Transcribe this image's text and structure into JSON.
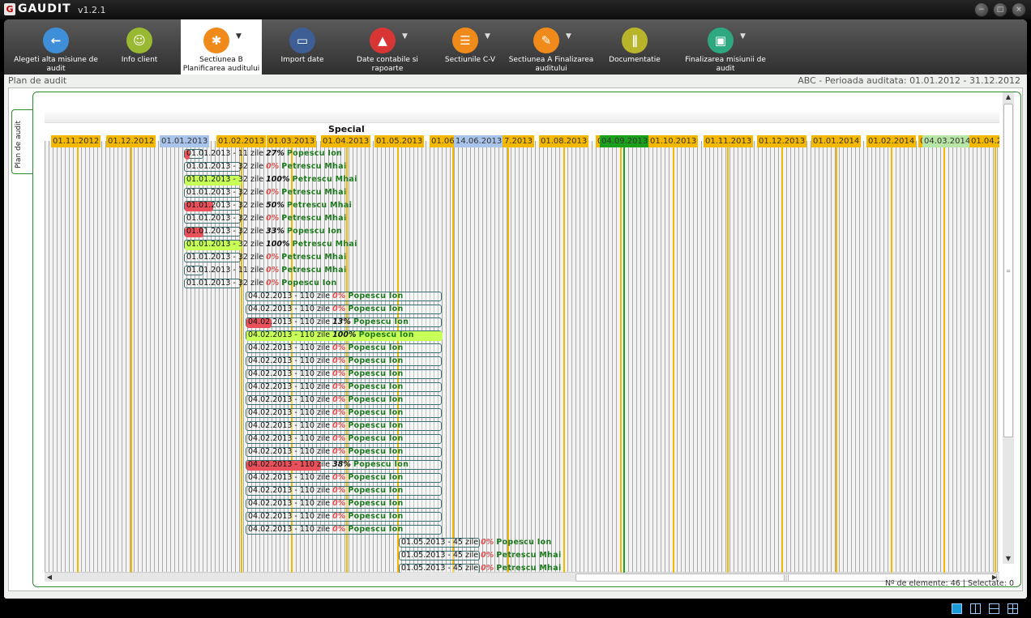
{
  "app": {
    "title": "GAUDIT",
    "version": "v1.2.1",
    "icon": "app-logo-icon"
  },
  "window_controls": [
    "minimize",
    "maximize",
    "close"
  ],
  "toolbar": [
    {
      "label": "Alegeti alta misiune de audit",
      "icon": "arrow-left-icon",
      "color": "#3f8fd8",
      "dropdown": false,
      "active": false
    },
    {
      "label": "Info client",
      "icon": "users-icon",
      "color": "#9ab932",
      "dropdown": false,
      "active": false
    },
    {
      "label": "Sectiunea B Planificarea auditului",
      "icon": "puzzle-icon",
      "color": "#f08a1a",
      "dropdown": true,
      "active": true
    },
    {
      "label": "Import date",
      "icon": "monitor-import-icon",
      "color": "#3d5f96",
      "dropdown": false,
      "active": false
    },
    {
      "label": "Date contabile si rapoarte",
      "icon": "presentation-chart-icon",
      "color": "#d83535",
      "dropdown": true,
      "active": false
    },
    {
      "label": "Sectiunile C-V",
      "icon": "document-icon",
      "color": "#f08a1a",
      "dropdown": true,
      "active": false
    },
    {
      "label": "Sectiunea A Finalizarea auditului",
      "icon": "pen-icon",
      "color": "#f08a1a",
      "dropdown": true,
      "active": false
    },
    {
      "label": "Documentatie",
      "icon": "books-icon",
      "color": "#b9b52a",
      "dropdown": false,
      "active": false
    },
    {
      "label": "Finalizarea misiunii de audit",
      "icon": "briefcase-icon",
      "color": "#2ea880",
      "dropdown": true,
      "active": false
    }
  ],
  "breadcrumb": "Plan de audit",
  "period": "ABC - Perioada auditata: 01.01.2012 - 31.12.2012",
  "side_tab": "Plan de audit",
  "timeline": {
    "group_label": "Special",
    "months": [
      {
        "label": "01.11.2012",
        "style": "month"
      },
      {
        "label": "01.12.2012",
        "style": "month"
      },
      {
        "label": "01.01.2013",
        "style": "blue"
      },
      {
        "label": "01.02.2013",
        "style": "month"
      },
      {
        "label": "01.03.2013",
        "style": "month"
      },
      {
        "label": "01.04.2013",
        "style": "month"
      },
      {
        "label": "01.05.2013",
        "style": "month"
      },
      {
        "label": "01.06",
        "style": "month"
      },
      {
        "label": "14.06.2013",
        "style": "ref"
      },
      {
        "label": "7.2013",
        "style": "month"
      },
      {
        "label": "01.08.2013",
        "style": "month"
      },
      {
        "label": "0",
        "style": "month"
      },
      {
        "label": "04.09.2013",
        "style": "green"
      },
      {
        "label": "01.10.2013",
        "style": "month"
      },
      {
        "label": "01.11.2013",
        "style": "month"
      },
      {
        "label": "01.12.2013",
        "style": "month"
      },
      {
        "label": "01.01.2014",
        "style": "month"
      },
      {
        "label": "01.02.2014",
        "style": "month"
      },
      {
        "label": "0",
        "style": "month"
      },
      {
        "label": "04.03.2014",
        "style": "lightgreen"
      },
      {
        "label": "01.04.201",
        "style": "month"
      }
    ],
    "tasks": [
      {
        "start": "01.01.2013",
        "days": "11",
        "pct": "27%",
        "pct_num": 27,
        "owner": "Popescu Ion"
      },
      {
        "start": "01.01.2013",
        "days": "32",
        "pct": "0%",
        "pct_num": 0,
        "owner": "Petrescu Mhai"
      },
      {
        "start": "01.01.2013",
        "days": "32",
        "pct": "100%",
        "pct_num": 100,
        "owner": "Petrescu Mhai"
      },
      {
        "start": "01.01.2013",
        "days": "32",
        "pct": "0%",
        "pct_num": 0,
        "owner": "Petrescu Mhai"
      },
      {
        "start": "01.01.2013",
        "days": "32",
        "pct": "50%",
        "pct_num": 50,
        "owner": "Petrescu Mhai"
      },
      {
        "start": "01.01.2013",
        "days": "32",
        "pct": "0%",
        "pct_num": 0,
        "owner": "Petrescu Mhai"
      },
      {
        "start": "01.01.2013",
        "days": "32",
        "pct": "33%",
        "pct_num": 33,
        "owner": "Popescu Ion"
      },
      {
        "start": "01.01.2013",
        "days": "32",
        "pct": "100%",
        "pct_num": 100,
        "owner": "Petrescu Mhai"
      },
      {
        "start": "01.01.2013",
        "days": "32",
        "pct": "0%",
        "pct_num": 0,
        "owner": "Petrescu Mhai"
      },
      {
        "start": "01.01.2013",
        "days": "11",
        "pct": "0%",
        "pct_num": 0,
        "owner": "Petrescu Mhai"
      },
      {
        "start": "01.01.2013",
        "days": "32",
        "pct": "0%",
        "pct_num": 0,
        "owner": "Popescu Ion"
      },
      {
        "start": "04.02.2013",
        "days": "110",
        "pct": "0%",
        "pct_num": 0,
        "owner": "Popescu Ion"
      },
      {
        "start": "04.02.2013",
        "days": "110",
        "pct": "0%",
        "pct_num": 0,
        "owner": "Popescu Ion"
      },
      {
        "start": "04.02.2013",
        "days": "110",
        "pct": "13%",
        "pct_num": 13,
        "owner": "Popescu Ion"
      },
      {
        "start": "04.02.2013",
        "days": "110",
        "pct": "100%",
        "pct_num": 100,
        "owner": "Popescu Ion"
      },
      {
        "start": "04.02.2013",
        "days": "110",
        "pct": "0%",
        "pct_num": 0,
        "owner": "Popescu Ion"
      },
      {
        "start": "04.02.2013",
        "days": "110",
        "pct": "0%",
        "pct_num": 0,
        "owner": "Popescu Ion"
      },
      {
        "start": "04.02.2013",
        "days": "110",
        "pct": "0%",
        "pct_num": 0,
        "owner": "Popescu Ion"
      },
      {
        "start": "04.02.2013",
        "days": "110",
        "pct": "0%",
        "pct_num": 0,
        "owner": "Popescu Ion"
      },
      {
        "start": "04.02.2013",
        "days": "110",
        "pct": "0%",
        "pct_num": 0,
        "owner": "Popescu Ion"
      },
      {
        "start": "04.02.2013",
        "days": "110",
        "pct": "0%",
        "pct_num": 0,
        "owner": "Popescu Ion"
      },
      {
        "start": "04.02.2013",
        "days": "110",
        "pct": "0%",
        "pct_num": 0,
        "owner": "Popescu Ion"
      },
      {
        "start": "04.02.2013",
        "days": "110",
        "pct": "0%",
        "pct_num": 0,
        "owner": "Popescu Ion"
      },
      {
        "start": "04.02.2013",
        "days": "110",
        "pct": "0%",
        "pct_num": 0,
        "owner": "Popescu Ion"
      },
      {
        "start": "04.02.2013",
        "days": "110",
        "pct": "38%",
        "pct_num": 38,
        "owner": "Popescu Ion"
      },
      {
        "start": "04.02.2013",
        "days": "110",
        "pct": "0%",
        "pct_num": 0,
        "owner": "Popescu Ion"
      },
      {
        "start": "04.02.2013",
        "days": "110",
        "pct": "0%",
        "pct_num": 0,
        "owner": "Popescu Ion"
      },
      {
        "start": "04.02.2013",
        "days": "110",
        "pct": "0%",
        "pct_num": 0,
        "owner": "Popescu Ion"
      },
      {
        "start": "04.02.2013",
        "days": "110",
        "pct": "0%",
        "pct_num": 0,
        "owner": "Popescu Ion"
      },
      {
        "start": "04.02.2013",
        "days": "110",
        "pct": "0%",
        "pct_num": 0,
        "owner": "Popescu Ion"
      },
      {
        "start": "01.05.2013",
        "days": "45",
        "pct": "0%",
        "pct_num": 0,
        "owner": "Popescu Ion"
      },
      {
        "start": "01.05.2013",
        "days": "45",
        "pct": "0%",
        "pct_num": 0,
        "owner": "Petrescu Mhai"
      },
      {
        "start": "01.05.2013",
        "days": "45",
        "pct": "0%",
        "pct_num": 0,
        "owner": "Petrescu Mhai"
      }
    ],
    "days_suffix": " zile ",
    "sep": " - "
  },
  "status": {
    "elements_label": "Nº de elemente: ",
    "elements": "46",
    "selected_label": " | Selectate: ",
    "selected": "0"
  },
  "colors": {
    "month": "#f5b800",
    "today": "#1aa01a",
    "start": "#a8c4ea",
    "done": "#c8ff58",
    "low": "#e8505a",
    "owner": "#1e7a1e"
  },
  "layout_buttons": [
    "single-view-icon",
    "split-vertical-icon",
    "split-horizontal-icon",
    "grid-view-icon"
  ]
}
